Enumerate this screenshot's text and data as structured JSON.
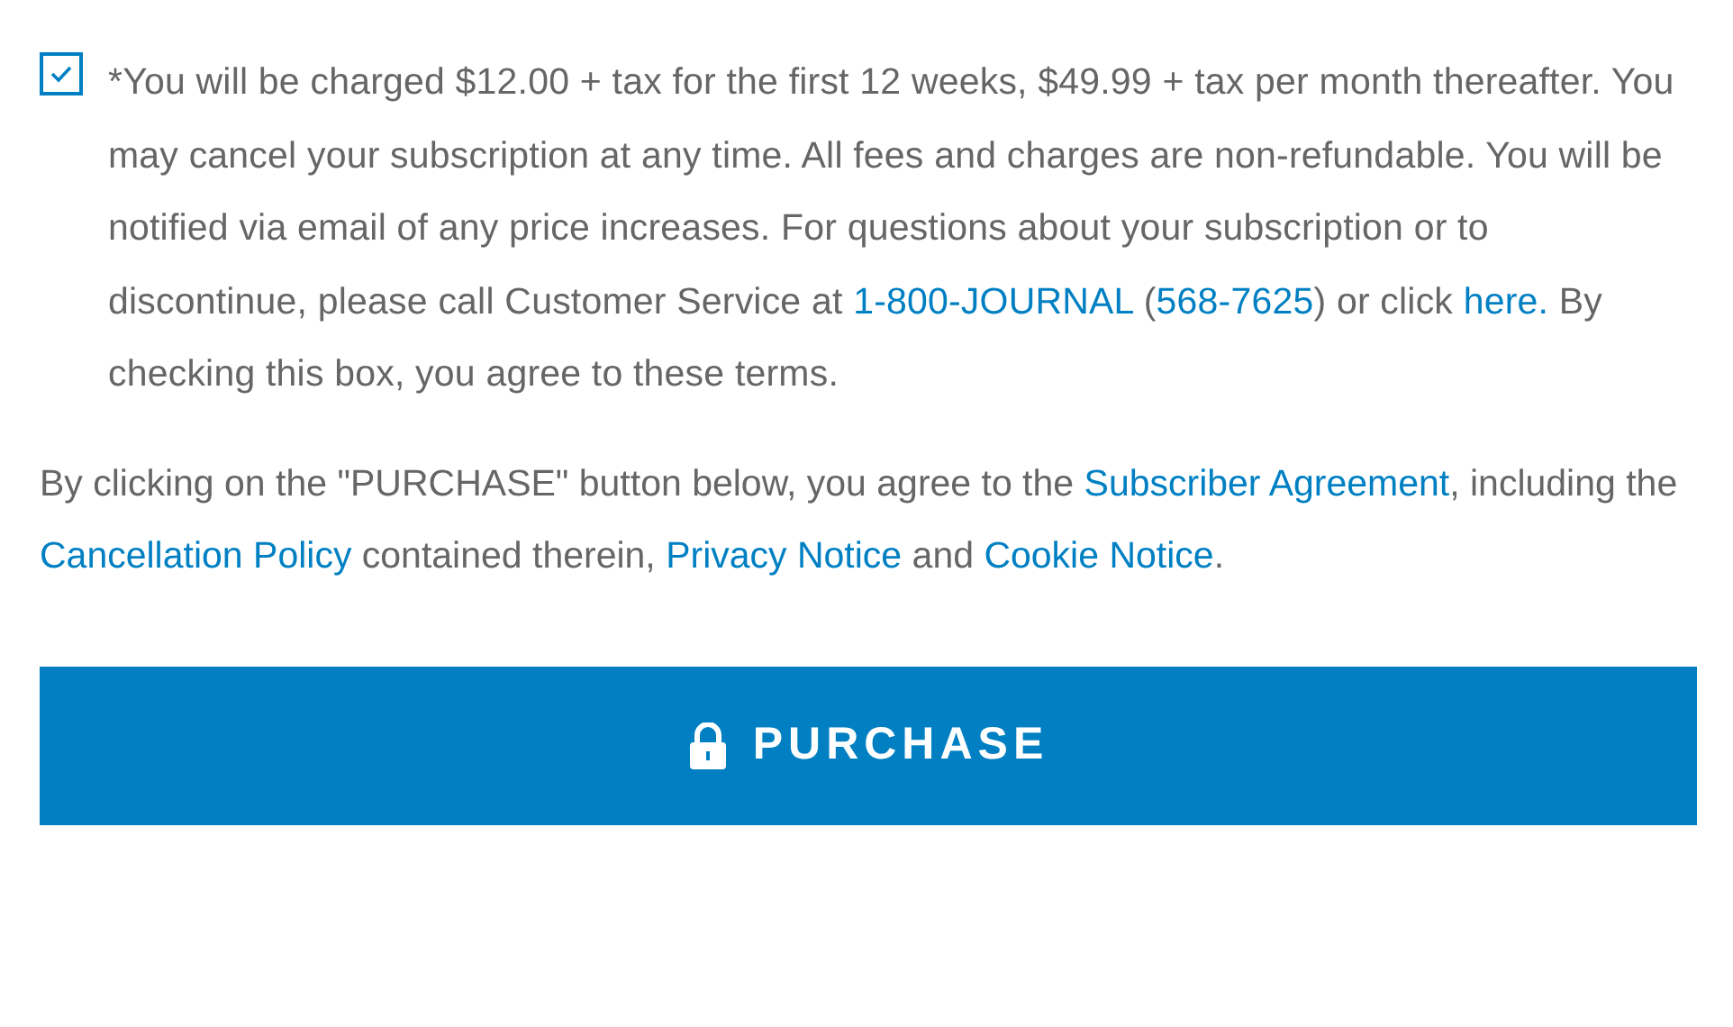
{
  "terms_checkbox": {
    "checked": true,
    "segments": [
      {
        "kind": "text",
        "text": "*You will be charged $12.00 + tax for the first 12 weeks, $49.99 + tax per month thereafter. You may cancel your subscription at any time. All fees and charges are non-refundable. You will be notified via email of any price increases. For questions about your subscription or to discontinue, please call Customer Service at "
      },
      {
        "kind": "link",
        "text": "1-800-JOURNAL"
      },
      {
        "kind": "text",
        "text": " ("
      },
      {
        "kind": "link",
        "text": "568-7625"
      },
      {
        "kind": "text",
        "text": ") or click "
      },
      {
        "kind": "link",
        "text": "here."
      },
      {
        "kind": "text",
        "text": " By checking this box, you agree to these terms."
      }
    ]
  },
  "agreement": {
    "segments": [
      {
        "kind": "text",
        "text": "By clicking on the \"PURCHASE\" button below, you agree to the "
      },
      {
        "kind": "link",
        "text": "Subscriber Agreement"
      },
      {
        "kind": "text",
        "text": ", including the "
      },
      {
        "kind": "link",
        "text": "Cancellation Policy"
      },
      {
        "kind": "text",
        "text": " contained therein, "
      },
      {
        "kind": "link",
        "text": "Privacy Notice"
      },
      {
        "kind": "text",
        "text": " and "
      },
      {
        "kind": "link",
        "text": "Cookie Notice"
      },
      {
        "kind": "text",
        "text": "."
      }
    ]
  },
  "purchase_button": {
    "label": "PURCHASE"
  }
}
